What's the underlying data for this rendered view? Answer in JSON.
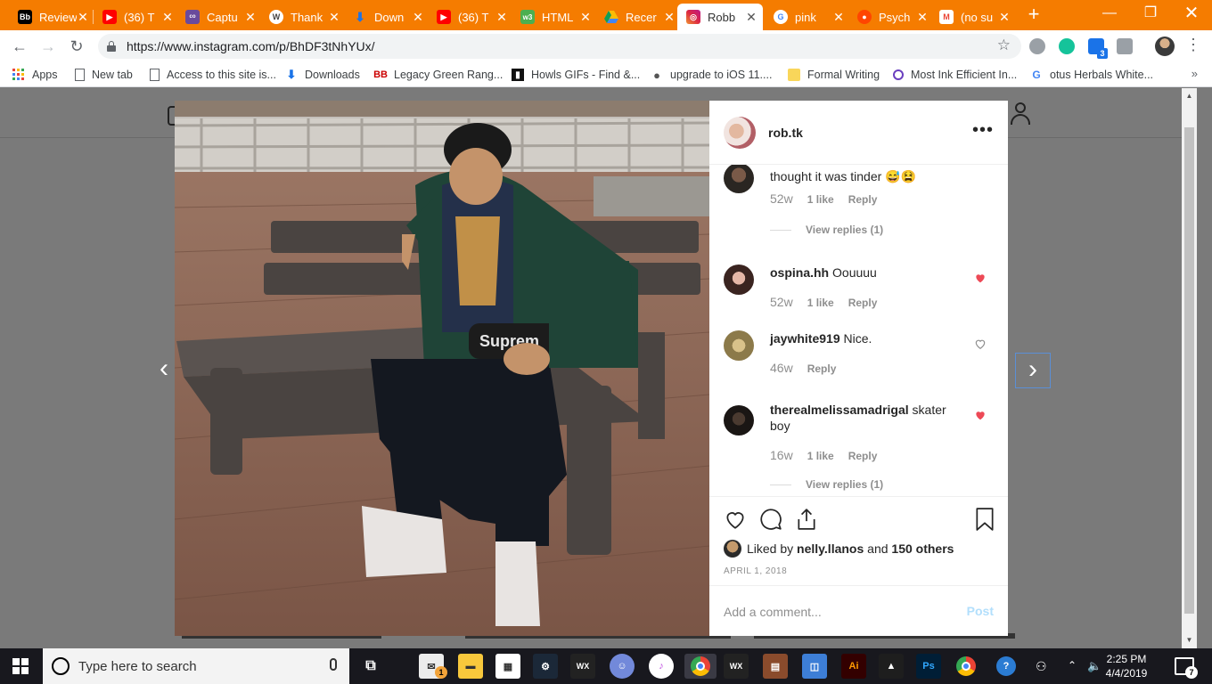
{
  "browser": {
    "tabs": [
      {
        "title": "Review",
        "icon": "Bb",
        "color": "#000000"
      },
      {
        "title": "(36) T",
        "icon": "yt",
        "color": "#ff0000"
      },
      {
        "title": "Captu",
        "icon": "co",
        "color": "#6a4a9c"
      },
      {
        "title": "Thank",
        "icon": "W",
        "color": "#464342"
      },
      {
        "title": "Down",
        "icon": "dl",
        "color": "#1a73e8"
      },
      {
        "title": "(36) T",
        "icon": "yt",
        "color": "#ff0000"
      },
      {
        "title": "HTML",
        "icon": "w3",
        "color": "#4caf50"
      },
      {
        "title": "Recer",
        "icon": "dr",
        "color": "#fbbc04"
      },
      {
        "title": "Robb",
        "icon": "ig",
        "color": "#c13584",
        "active": true
      },
      {
        "title": "pink",
        "icon": "G",
        "color": "#4285f4"
      },
      {
        "title": "Psych",
        "icon": "rd",
        "color": "#ff4500"
      },
      {
        "title": "(no su",
        "icon": "M",
        "color": "#ea4335"
      }
    ],
    "url": "https://www.instagram.com/p/BhDF3tNhYUx/",
    "bookmarks": [
      {
        "label": "Apps"
      },
      {
        "label": "New tab"
      },
      {
        "label": "Access to this site is..."
      },
      {
        "label": "Downloads"
      },
      {
        "label": "Legacy Green Rang..."
      },
      {
        "label": "Howls GIFs - Find &..."
      },
      {
        "label": "upgrade to iOS 11...."
      },
      {
        "label": "Formal Writing"
      },
      {
        "label": "Most Ink Efficient In..."
      },
      {
        "label": "otus Herbals White..."
      }
    ],
    "extension_badge": "3"
  },
  "post": {
    "username": "rob.tk",
    "comments": [
      {
        "user": "",
        "text": "thought it was tinder 😅😫",
        "age": "52w",
        "likes": "1 like",
        "reply": "Reply",
        "view_replies": "View replies (1)",
        "liked": false
      },
      {
        "user": "ospina.hh",
        "text": "Oouuuu",
        "age": "52w",
        "likes": "1 like",
        "reply": "Reply",
        "liked": true
      },
      {
        "user": "jaywhite919",
        "text": "Nice.",
        "age": "46w",
        "reply": "Reply",
        "liked": false
      },
      {
        "user": "therealmelissamadrigal",
        "text": "skater boy",
        "age": "16w",
        "likes": "1 like",
        "reply": "Reply",
        "view_replies": "View replies (1)",
        "liked": true
      }
    ],
    "liked_by_prefix": "Liked by",
    "liked_by_user": "nelly.llanos",
    "liked_by_and": "and",
    "liked_by_others": "150 others",
    "date": "APRIL 1, 2018",
    "comment_placeholder": "Add a comment...",
    "post_button": "Post",
    "photo_text": "Suprem"
  },
  "taskbar": {
    "search_placeholder": "Type here to search",
    "time": "2:25 PM",
    "date": "4/4/2019",
    "mail_badge": "1",
    "notification_count": "7"
  },
  "colors": {
    "chrome_accent": "#f57c00",
    "heart_red": "#ed4956",
    "link_blue": "#b2dffc"
  }
}
